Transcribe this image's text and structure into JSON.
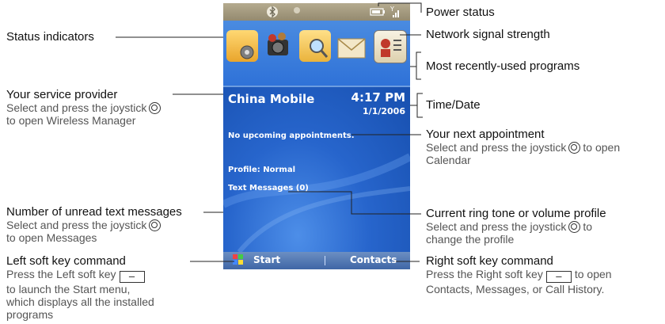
{
  "phone": {
    "provider": "China Mobile",
    "time": "4:17 PM",
    "date": "1/1/2006",
    "appointment": "No upcoming appointments.",
    "profile": "Profile: Normal",
    "messages": "Text Messages (0)",
    "soft_left": "Start",
    "soft_right": "Contacts"
  },
  "callouts": {
    "status_indicators": "Status indicators",
    "provider": {
      "title": "Your service provider",
      "line1a": "Select and press the joystick",
      "line2": "to open Wireless Manager"
    },
    "unread": {
      "title": "Number of unread text messages",
      "line1a": "Select and press the joystick",
      "line2": "to open Messages"
    },
    "left_soft": {
      "title": "Left soft key command",
      "line1a": "Press the Left soft key",
      "line2": "to launch the Start menu,",
      "line3": "which displays all the installed",
      "line4": "programs"
    },
    "power": "Power status",
    "signal": "Network signal strength",
    "recent": "Most recently-used programs",
    "timedate": "Time/Date",
    "appointment": {
      "title": "Your next appointment",
      "line1a": "Select and press the joystick",
      "line1b": "to open",
      "line2": "Calendar"
    },
    "ringtone": {
      "title": "Current ring tone or volume profile",
      "line1a": "Select and press the joystick",
      "line1b": "to",
      "line2": "change the profile"
    },
    "right_soft": {
      "title": "Right soft key command",
      "line1a": "Press the Right soft key",
      "line1b": "to open",
      "line2": "Contacts, Messages, or Call History."
    }
  },
  "icons": {
    "joystick": "joystick-icon",
    "softkey": "softkey-icon",
    "bluetooth": "bluetooth-icon",
    "battery": "battery-icon",
    "signal": "signal-icon",
    "windows": "windows-flag-icon"
  }
}
